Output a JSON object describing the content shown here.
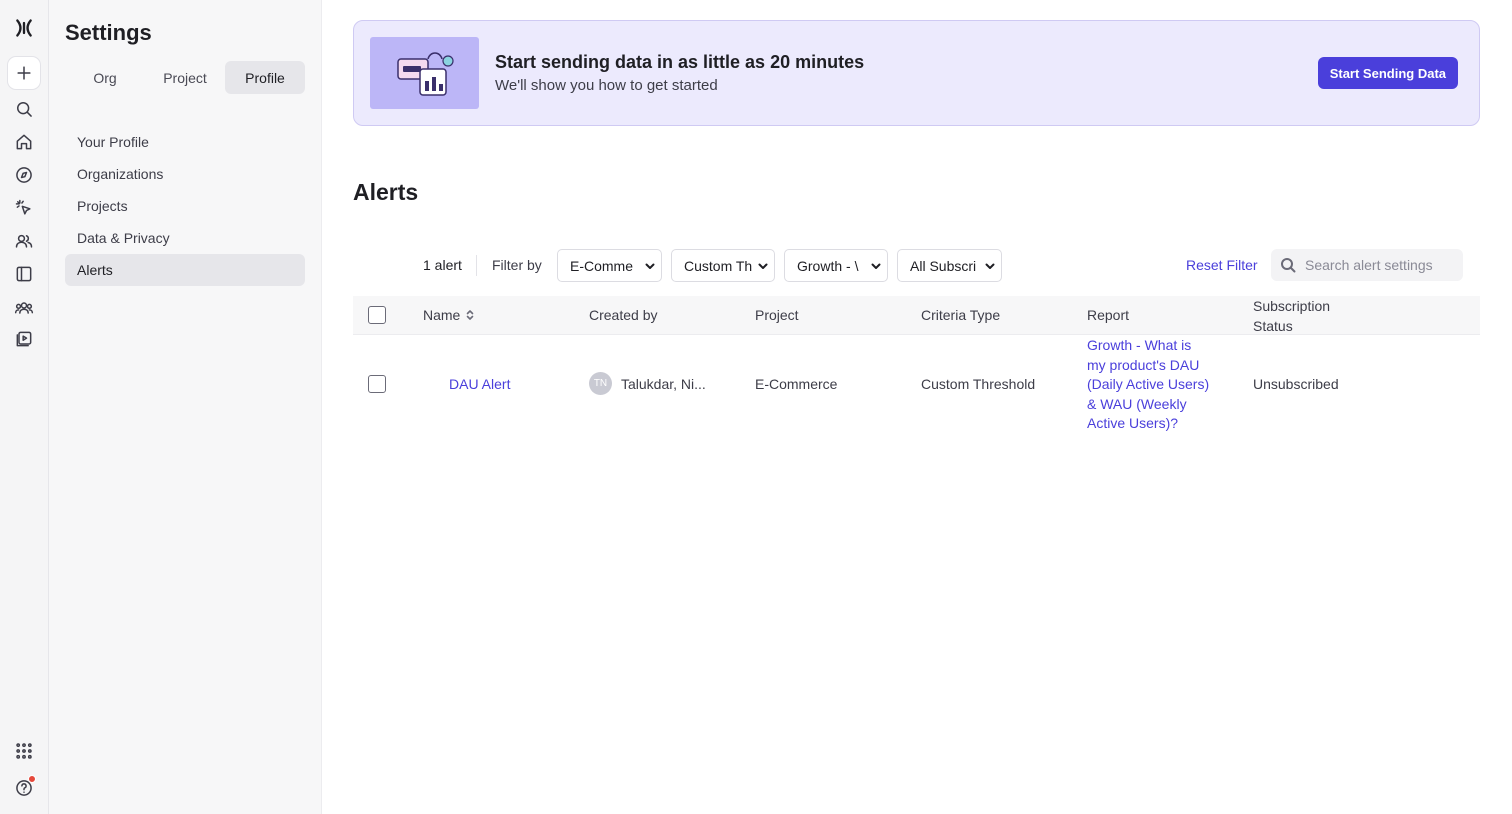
{
  "sidebar": {
    "title": "Settings",
    "tabs": [
      {
        "label": "Org"
      },
      {
        "label": "Project"
      },
      {
        "label": "Profile",
        "active": true
      }
    ],
    "items": [
      {
        "label": "Your Profile"
      },
      {
        "label": "Organizations"
      },
      {
        "label": "Projects"
      },
      {
        "label": "Data & Privacy"
      },
      {
        "label": "Alerts",
        "active": true
      }
    ]
  },
  "banner": {
    "title": "Start sending data in as little as 20 minutes",
    "subtitle": "We'll show you how to get started",
    "button_label": "Start Sending Data"
  },
  "page": {
    "title": "Alerts"
  },
  "toolbar": {
    "count": "1 alert",
    "filter_label": "Filter by",
    "filters": [
      "E-Comme",
      "Custom Th",
      "Growth - \\",
      "All Subscri"
    ],
    "reset_label": "Reset Filter",
    "search_placeholder": "Search alert settings"
  },
  "table": {
    "headers": {
      "name": "Name",
      "created_by": "Created by",
      "project": "Project",
      "criteria_type": "Criteria Type",
      "report": "Report",
      "subscription_line1": "Subscription",
      "subscription_line2": "Status"
    },
    "rows": [
      {
        "name": "DAU Alert",
        "avatar_initials": "TN",
        "created_by": "Talukdar, Ni...",
        "project": "E-Commerce",
        "criteria_type": "Custom Threshold",
        "report_lines": [
          "Growth - What is",
          "my product's DAU",
          "(Daily Active Users)",
          "& WAU (Weekly",
          "Active Users)?"
        ],
        "subscription_status": "Unsubscribed"
      }
    ]
  },
  "colors": {
    "accent": "#4a3fdb",
    "banner_bg": "#eceafd",
    "notification": "#e5483b"
  },
  "rail_icons": [
    "mixpanel-logo-icon",
    "plus-icon",
    "search-icon",
    "home-icon",
    "compass-icon",
    "cursor-click-icon",
    "users-icon",
    "sidebar-layout-icon",
    "team-icon",
    "play-media-icon",
    "apps-grid-icon",
    "help-icon"
  ]
}
